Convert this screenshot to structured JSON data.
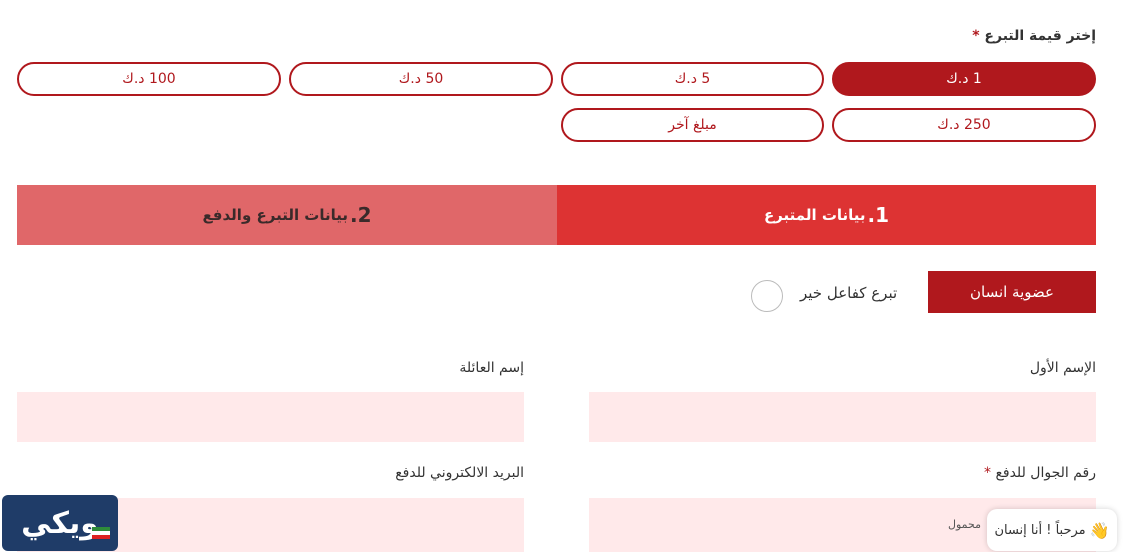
{
  "donation": {
    "title": "إختر قيمة التبرع",
    "required_mark": "*",
    "amounts": [
      "1 د.ك",
      "5 د.ك",
      "50 د.ك",
      "100 د.ك",
      "250 د.ك",
      "مبلغ آخر"
    ],
    "selected": "1 د.ك"
  },
  "steps": [
    {
      "num": "1.",
      "label": "بيانات المتبرع"
    },
    {
      "num": "2.",
      "label": "بيانات التبرع والدفع"
    }
  ],
  "donor_type": {
    "membership_label": "عضوية انسان",
    "charity_label": "تبرع كفاعل خير"
  },
  "form": {
    "first_name_label": "الإسم الأول",
    "family_name_label": "إسم العائلة",
    "mobile_label": "رقم الجوال للدفع",
    "mobile_required": "*",
    "email_label": "البريد الالكتروني للدفع",
    "mobile_hint": "محمول"
  },
  "chat": {
    "text": "مرحباً ! أنا إنسان",
    "icon": "wave-hand-icon"
  },
  "logo": {
    "text": "ويكي"
  },
  "colors": {
    "brand": "#b0181d",
    "step_active": "#dd3333",
    "step_inactive": "#e06769",
    "input_bg": "#ffe9ea"
  }
}
